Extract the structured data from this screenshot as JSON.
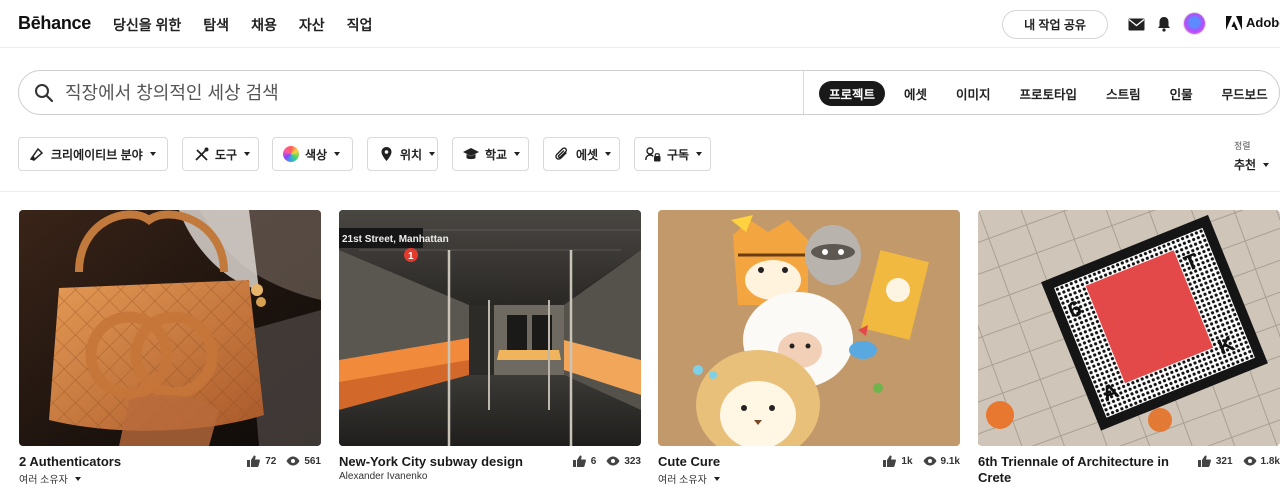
{
  "nav": {
    "logo": "Bēhance",
    "links": [
      "당신을 위한",
      "탐색",
      "채용",
      "자산",
      "직업"
    ],
    "share_label": "내 작업 공유",
    "adobe_label": "Adobe"
  },
  "search": {
    "placeholder": "직장에서 창의적인 세상 검색",
    "tabs": [
      {
        "label": "프로젝트",
        "active": true
      },
      {
        "label": "에셋",
        "active": false
      },
      {
        "label": "이미지",
        "active": false
      },
      {
        "label": "프로토타입",
        "active": false
      },
      {
        "label": "스트림",
        "active": false
      },
      {
        "label": "인물",
        "active": false
      },
      {
        "label": "무드보드",
        "active": false
      }
    ]
  },
  "filters": [
    {
      "label": "크리에이티브 분야",
      "icon": "creative-field-icon"
    },
    {
      "label": "도구",
      "icon": "tools-icon"
    },
    {
      "label": "색상",
      "icon": "color-wheel-icon"
    },
    {
      "label": "위치",
      "icon": "location-pin-icon"
    },
    {
      "label": "학교",
      "icon": "graduation-cap-icon"
    },
    {
      "label": "에셋",
      "icon": "paperclip-icon"
    },
    {
      "label": "구독",
      "icon": "subscription-lock-icon"
    }
  ],
  "sort": {
    "label": "정렬",
    "value": "추천"
  },
  "projects": [
    {
      "title": "2 Authenticators",
      "owner": "여러 소유자",
      "owner_dropdown": true,
      "likes": "72",
      "views": "561",
      "image": "quilted-handbag"
    },
    {
      "title": "New-York City subway design",
      "owner": "Alexander Ivanenko",
      "owner_dropdown": false,
      "likes": "6",
      "views": "323",
      "image": "subway-car-interior",
      "sign_text": "21st Street, Manhattan",
      "line_number": "1"
    },
    {
      "title": "Cute Cure",
      "owner": "여러 소유자",
      "owner_dropdown": true,
      "likes": "1k",
      "views": "9.1k",
      "image": "cardboard-animal-cutouts"
    },
    {
      "title": "6th Triennale of Architecture in Crete",
      "owner": "",
      "owner_dropdown": false,
      "likes": "321",
      "views": "1.8k",
      "image": "poster-on-pavement",
      "poster_letters": [
        "6",
        "T",
        "A",
        "K"
      ]
    }
  ],
  "colors": {
    "accent": "#191919",
    "subway_orange": "#f28a3c",
    "poster_red": "#e4494a"
  }
}
